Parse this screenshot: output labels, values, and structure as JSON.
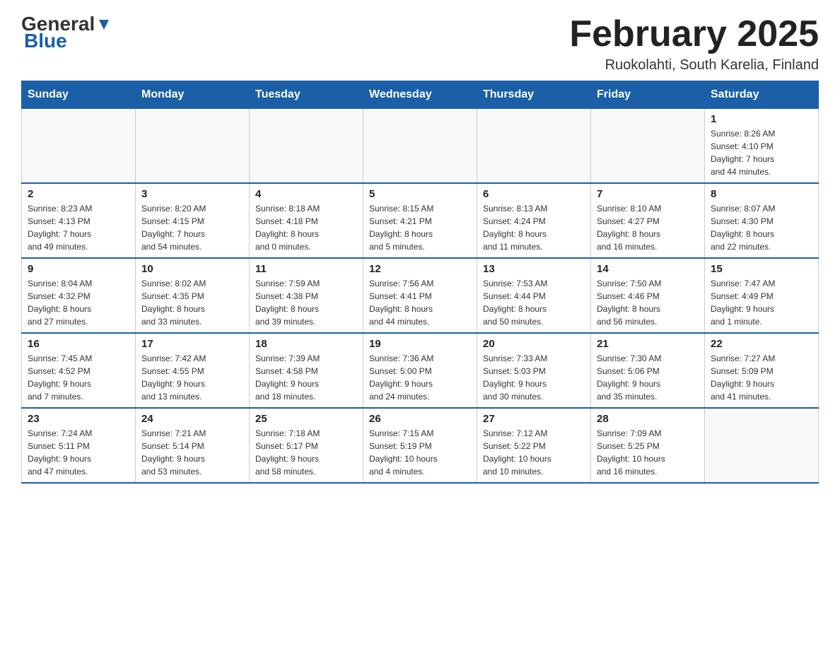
{
  "logo": {
    "general": "General",
    "blue": "Blue"
  },
  "header": {
    "title": "February 2025",
    "location": "Ruokolahti, South Karelia, Finland"
  },
  "weekdays": [
    "Sunday",
    "Monday",
    "Tuesday",
    "Wednesday",
    "Thursday",
    "Friday",
    "Saturday"
  ],
  "weeks": [
    [
      {
        "day": "",
        "info": ""
      },
      {
        "day": "",
        "info": ""
      },
      {
        "day": "",
        "info": ""
      },
      {
        "day": "",
        "info": ""
      },
      {
        "day": "",
        "info": ""
      },
      {
        "day": "",
        "info": ""
      },
      {
        "day": "1",
        "info": "Sunrise: 8:26 AM\nSunset: 4:10 PM\nDaylight: 7 hours\nand 44 minutes."
      }
    ],
    [
      {
        "day": "2",
        "info": "Sunrise: 8:23 AM\nSunset: 4:13 PM\nDaylight: 7 hours\nand 49 minutes."
      },
      {
        "day": "3",
        "info": "Sunrise: 8:20 AM\nSunset: 4:15 PM\nDaylight: 7 hours\nand 54 minutes."
      },
      {
        "day": "4",
        "info": "Sunrise: 8:18 AM\nSunset: 4:18 PM\nDaylight: 8 hours\nand 0 minutes."
      },
      {
        "day": "5",
        "info": "Sunrise: 8:15 AM\nSunset: 4:21 PM\nDaylight: 8 hours\nand 5 minutes."
      },
      {
        "day": "6",
        "info": "Sunrise: 8:13 AM\nSunset: 4:24 PM\nDaylight: 8 hours\nand 11 minutes."
      },
      {
        "day": "7",
        "info": "Sunrise: 8:10 AM\nSunset: 4:27 PM\nDaylight: 8 hours\nand 16 minutes."
      },
      {
        "day": "8",
        "info": "Sunrise: 8:07 AM\nSunset: 4:30 PM\nDaylight: 8 hours\nand 22 minutes."
      }
    ],
    [
      {
        "day": "9",
        "info": "Sunrise: 8:04 AM\nSunset: 4:32 PM\nDaylight: 8 hours\nand 27 minutes."
      },
      {
        "day": "10",
        "info": "Sunrise: 8:02 AM\nSunset: 4:35 PM\nDaylight: 8 hours\nand 33 minutes."
      },
      {
        "day": "11",
        "info": "Sunrise: 7:59 AM\nSunset: 4:38 PM\nDaylight: 8 hours\nand 39 minutes."
      },
      {
        "day": "12",
        "info": "Sunrise: 7:56 AM\nSunset: 4:41 PM\nDaylight: 8 hours\nand 44 minutes."
      },
      {
        "day": "13",
        "info": "Sunrise: 7:53 AM\nSunset: 4:44 PM\nDaylight: 8 hours\nand 50 minutes."
      },
      {
        "day": "14",
        "info": "Sunrise: 7:50 AM\nSunset: 4:46 PM\nDaylight: 8 hours\nand 56 minutes."
      },
      {
        "day": "15",
        "info": "Sunrise: 7:47 AM\nSunset: 4:49 PM\nDaylight: 9 hours\nand 1 minute."
      }
    ],
    [
      {
        "day": "16",
        "info": "Sunrise: 7:45 AM\nSunset: 4:52 PM\nDaylight: 9 hours\nand 7 minutes."
      },
      {
        "day": "17",
        "info": "Sunrise: 7:42 AM\nSunset: 4:55 PM\nDaylight: 9 hours\nand 13 minutes."
      },
      {
        "day": "18",
        "info": "Sunrise: 7:39 AM\nSunset: 4:58 PM\nDaylight: 9 hours\nand 18 minutes."
      },
      {
        "day": "19",
        "info": "Sunrise: 7:36 AM\nSunset: 5:00 PM\nDaylight: 9 hours\nand 24 minutes."
      },
      {
        "day": "20",
        "info": "Sunrise: 7:33 AM\nSunset: 5:03 PM\nDaylight: 9 hours\nand 30 minutes."
      },
      {
        "day": "21",
        "info": "Sunrise: 7:30 AM\nSunset: 5:06 PM\nDaylight: 9 hours\nand 35 minutes."
      },
      {
        "day": "22",
        "info": "Sunrise: 7:27 AM\nSunset: 5:09 PM\nDaylight: 9 hours\nand 41 minutes."
      }
    ],
    [
      {
        "day": "23",
        "info": "Sunrise: 7:24 AM\nSunset: 5:11 PM\nDaylight: 9 hours\nand 47 minutes."
      },
      {
        "day": "24",
        "info": "Sunrise: 7:21 AM\nSunset: 5:14 PM\nDaylight: 9 hours\nand 53 minutes."
      },
      {
        "day": "25",
        "info": "Sunrise: 7:18 AM\nSunset: 5:17 PM\nDaylight: 9 hours\nand 58 minutes."
      },
      {
        "day": "26",
        "info": "Sunrise: 7:15 AM\nSunset: 5:19 PM\nDaylight: 10 hours\nand 4 minutes."
      },
      {
        "day": "27",
        "info": "Sunrise: 7:12 AM\nSunset: 5:22 PM\nDaylight: 10 hours\nand 10 minutes."
      },
      {
        "day": "28",
        "info": "Sunrise: 7:09 AM\nSunset: 5:25 PM\nDaylight: 10 hours\nand 16 minutes."
      },
      {
        "day": "",
        "info": ""
      }
    ]
  ]
}
